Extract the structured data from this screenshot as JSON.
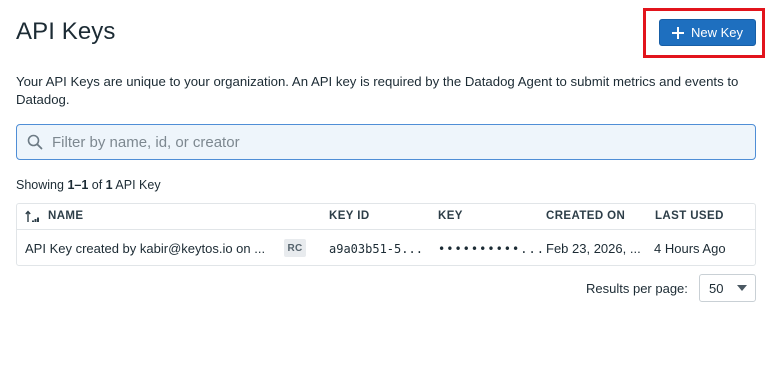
{
  "header": {
    "title": "API Keys",
    "new_key_label": "New Key"
  },
  "description": "Your API Keys are unique to your organization. An API key is required by the Datadog Agent to submit metrics and events to Datadog.",
  "filter": {
    "placeholder": "Filter by name, id, or creator",
    "value": ""
  },
  "summary": {
    "prefix": "Showing ",
    "range": "1–1",
    "middle": " of ",
    "total": "1",
    "suffix": " API Key"
  },
  "table": {
    "columns": {
      "name": "NAME",
      "key_id": "KEY ID",
      "key": "KEY",
      "created_on": "CREATED ON",
      "last_used": "LAST USED"
    },
    "rows": [
      {
        "name": "API Key created by kabir@keytos.io on ...",
        "badge": "RC",
        "key_id": "a9a03b51-5...",
        "key": "••••••••••...",
        "created_on": "Feb 23, 2026, ...",
        "last_used": "4 Hours Ago"
      }
    ]
  },
  "pagination": {
    "results_per_page_label": "Results per page:",
    "results_per_page_value": "50"
  },
  "colors": {
    "primary": "#1e6fbf",
    "highlight": "#e2141c",
    "filter_bg": "#eef5fb"
  }
}
